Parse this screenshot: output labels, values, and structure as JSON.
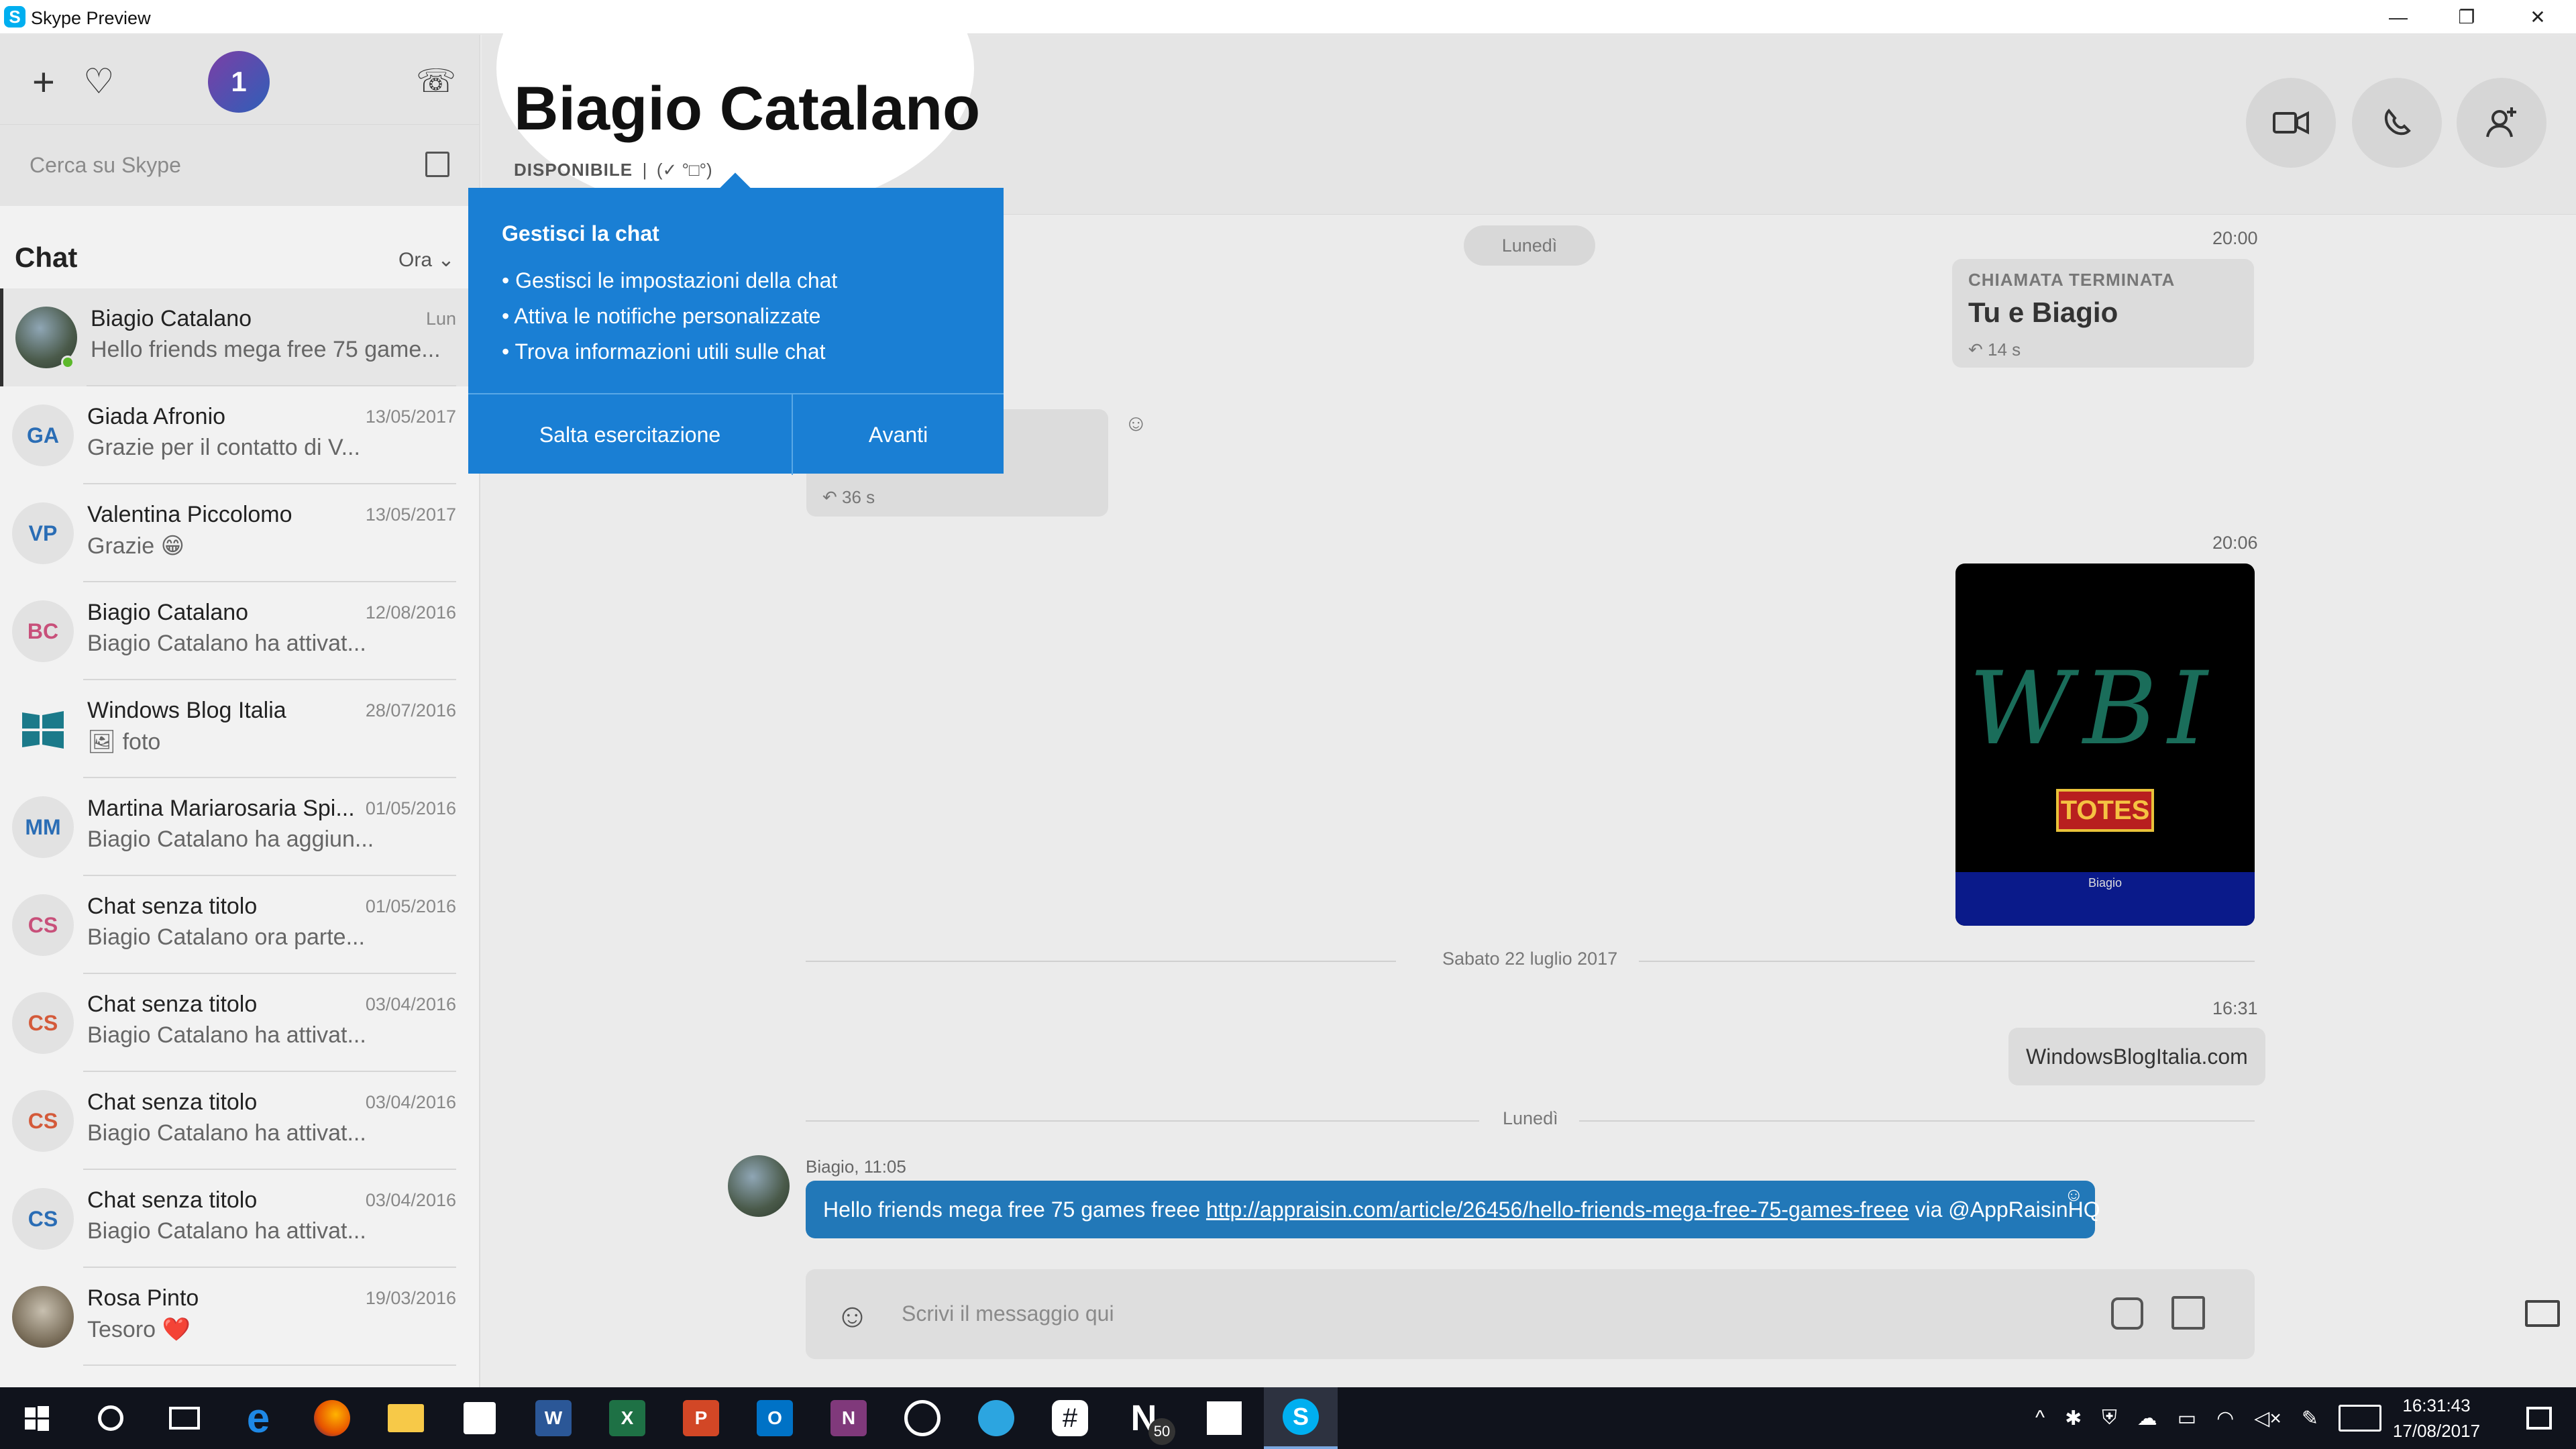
{
  "window": {
    "title": "Skype Preview",
    "minimize_glyph": "—",
    "maximize_glyph": "❐",
    "close_glyph": "✕"
  },
  "sidebar": {
    "top": {
      "add_glyph": "+",
      "favorite_glyph": "♡",
      "notification_count": "1",
      "call_history_glyph": "☏"
    },
    "search": {
      "placeholder": "Cerca su Skype"
    },
    "chat_header": "Chat",
    "sort_label": "Ora ⌄",
    "chats": [
      {
        "name": "Biagio Catalano",
        "preview": "Hello friends mega free 75 game...",
        "date": "Lun",
        "avatar": "photo",
        "initials": "",
        "color": ""
      },
      {
        "name": "Giada Afronio",
        "preview": "Grazie per il contatto di V...",
        "date": "13/05/2017",
        "avatar": "initials",
        "initials": "GA",
        "color": "#2a6db5"
      },
      {
        "name": "Valentina Piccolomo",
        "preview": "Grazie 😁",
        "date": "13/05/2017",
        "avatar": "initials",
        "initials": "VP",
        "color": "#2a6db5"
      },
      {
        "name": "Biagio Catalano",
        "preview": "Biagio Catalano ha attivat...",
        "date": "12/08/2016",
        "avatar": "initials",
        "initials": "BC",
        "color": "#c8507a"
      },
      {
        "name": "Windows Blog Italia",
        "preview": "🖼 foto",
        "date": "28/07/2016",
        "avatar": "wbi",
        "initials": "",
        "color": ""
      },
      {
        "name": "Martina Mariarosaria Spi...",
        "preview": "Biagio Catalano ha aggiun...",
        "date": "01/05/2016",
        "avatar": "initials",
        "initials": "MM",
        "color": "#2a6db5"
      },
      {
        "name": "Chat senza titolo",
        "preview": "Biagio Catalano ora parte...",
        "date": "01/05/2016",
        "avatar": "initials",
        "initials": "CS",
        "color": "#c8507a"
      },
      {
        "name": "Chat senza titolo",
        "preview": "Biagio Catalano ha attivat...",
        "date": "03/04/2016",
        "avatar": "initials",
        "initials": "CS",
        "color": "#d45a3a"
      },
      {
        "name": "Chat senza titolo",
        "preview": "Biagio Catalano ha attivat...",
        "date": "03/04/2016",
        "avatar": "initials",
        "initials": "CS",
        "color": "#d45a3a"
      },
      {
        "name": "Chat senza titolo",
        "preview": "Biagio Catalano ha attivat...",
        "date": "03/04/2016",
        "avatar": "initials",
        "initials": "CS",
        "color": "#2a6db5"
      },
      {
        "name": "Rosa Pinto",
        "preview": "Tesoro ❤️",
        "date": "19/03/2016",
        "avatar": "photo2",
        "initials": "",
        "color": ""
      }
    ]
  },
  "conversation": {
    "contact_name": "Biagio Catalano",
    "status": "DISPONIBILE",
    "mood": "(✓ °□°)",
    "header_buttons": [
      "video-call",
      "audio-call",
      "add-contact"
    ],
    "day_pill": "Lunedì",
    "call_card_1": {
      "time": "20:00",
      "title": "CHIAMATA TERMINATA",
      "subtitle": "Tu e Biagio",
      "duration": "↶ 14 s"
    },
    "call_card_2": {
      "title": "TA",
      "duration": "↶ 36 s"
    },
    "image_message": {
      "time": "20:06",
      "caption": "Biagio",
      "sticker": "TOTES",
      "drawing": "WBI"
    },
    "divider_1": "Sabato 22 luglio 2017",
    "text_message_out": {
      "time": "16:31",
      "text": "WindowsBlogItalia.com"
    },
    "divider_2": "Lunedì",
    "incoming": {
      "meta": "Biagio, 11:05",
      "text_before": "Hello friends mega free 75 games freee ",
      "link": "http://appraisin.com/article/26456/hello-friends-mega-free-75-games-freee",
      "text_after": " via @AppRaisinHQ"
    },
    "composer": {
      "placeholder": "Scrivi il messaggio qui"
    }
  },
  "coach": {
    "title": "Gestisci la chat",
    "items": [
      "• Gestisci le impostazioni della chat",
      "• Attiva le notifiche personalizzate",
      "• Trova informazioni utili sulle chat"
    ],
    "skip_label": "Salta esercitazione",
    "next_label": "Avanti"
  },
  "taskbar": {
    "apps": [
      "start",
      "cortana",
      "task-view",
      "edge",
      "firefox",
      "file-explorer",
      "store",
      "word",
      "excel",
      "powerpoint",
      "outlook",
      "onenote",
      "whatsapp",
      "telegram",
      "slack",
      "nextgen-reader",
      "windows-blog-italia",
      "skype"
    ],
    "nextgen_badge": "50",
    "clock": {
      "time": "16:31:43",
      "date": "17/08/2017"
    }
  }
}
